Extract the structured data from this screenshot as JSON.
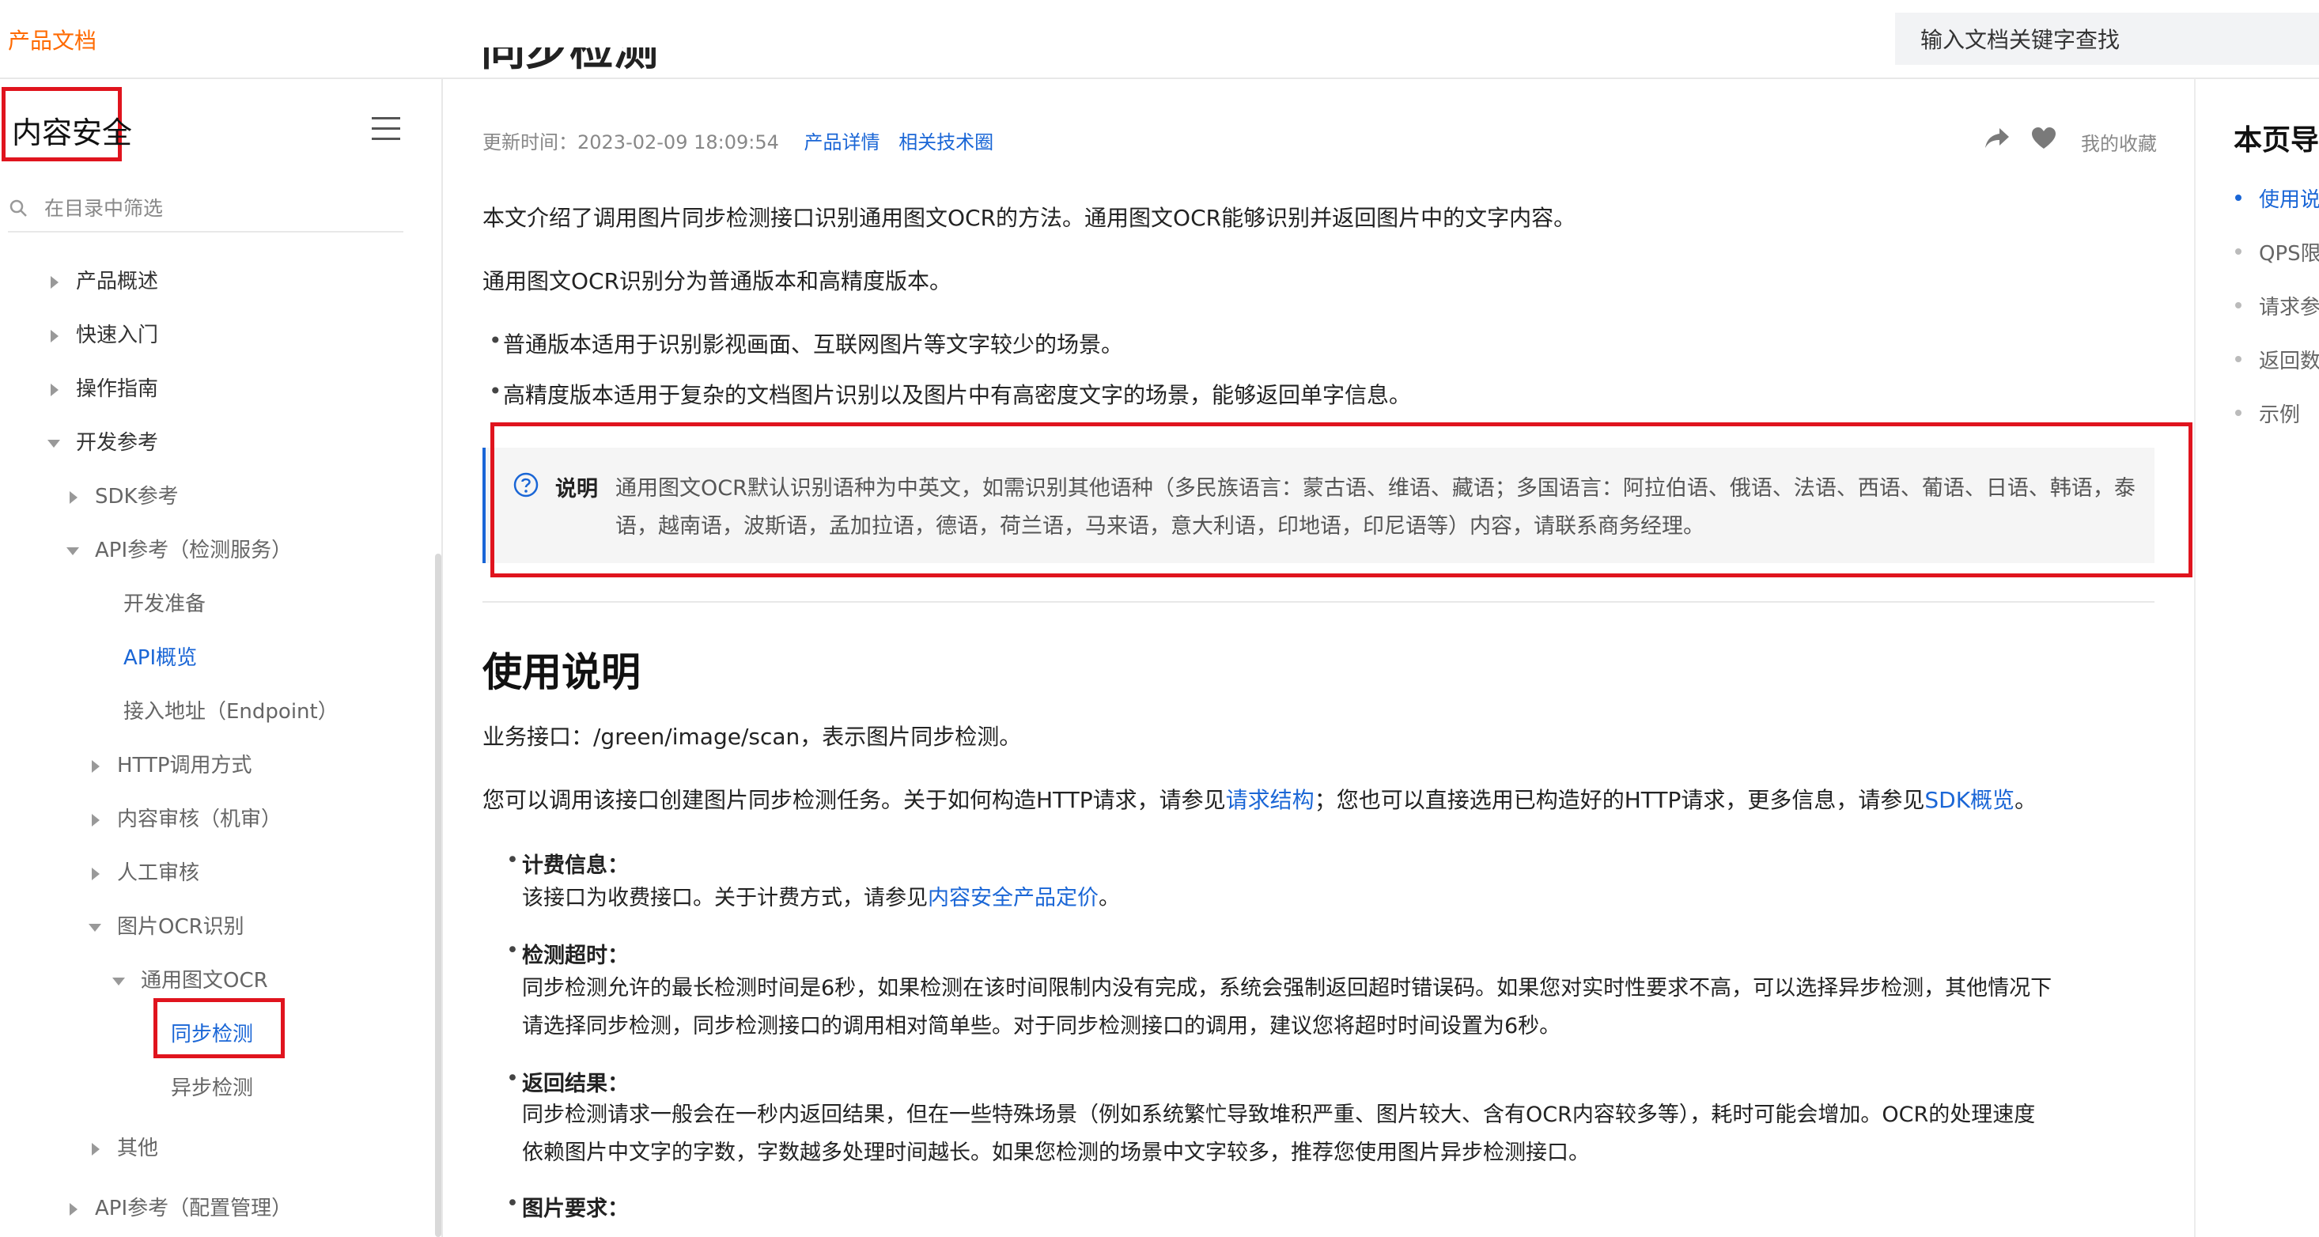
{
  "header": {
    "brand": "产品文档",
    "search_placeholder": "输入文档关键字查找"
  },
  "sidebar": {
    "title": "内容安全",
    "filter_placeholder": "在目录中筛选",
    "items": [
      {
        "label": "产品概述"
      },
      {
        "label": "快速入门"
      },
      {
        "label": "操作指南"
      },
      {
        "label": "开发参考"
      },
      {
        "label": "SDK参考"
      },
      {
        "label": "API参考（检测服务）"
      },
      {
        "label": "开发准备"
      },
      {
        "label": "API概览"
      },
      {
        "label": "接入地址（Endpoint）"
      },
      {
        "label": "HTTP调用方式"
      },
      {
        "label": "内容审核（机审）"
      },
      {
        "label": "人工审核"
      },
      {
        "label": "图片OCR识别"
      },
      {
        "label": "通用图文OCR"
      },
      {
        "label": "同步检测"
      },
      {
        "label": "异步检测"
      },
      {
        "label": "其他"
      },
      {
        "label": "API参考（配置管理）"
      }
    ]
  },
  "article": {
    "title": "同步检测",
    "meta": {
      "updated": "更新时间：2023-02-09 18:09:54",
      "link_detail": "产品详情",
      "link_circle": "相关技术圈",
      "favorite_label": "我的收藏"
    },
    "intro": "本文介绍了调用图片同步检测接口识别通用图文OCR的方法。通用图文OCR能够识别并返回图片中的文字内容。",
    "versions_intro": "通用图文OCR识别分为普通版本和高精度版本。",
    "versions": [
      "普通版本适用于识别影视画面、互联网图片等文字较少的场景。",
      "高精度版本适用于复杂的文档图片识别以及图片中有高密度文字的场景，能够返回单字信息。"
    ],
    "note": {
      "label": "说明",
      "text": "通用图文OCR默认识别语种为中英文，如需识别其他语种（多民族语言：蒙古语、维语、藏语；多国语言：阿拉伯语、俄语、法语、西语、葡语、日语、韩语，泰语，越南语，波斯语，孟加拉语，德语，荷兰语，马来语，意大利语，印地语，印尼语等）内容，请联系商务经理。"
    },
    "section_title": "使用说明",
    "api_line": "业务接口：/green/image/scan，表示图片同步检测。",
    "build_line": {
      "part1": "您可以调用该接口创建图片同步检测任务。关于如何构造HTTP请求，请参见",
      "link1": "请求结构",
      "part2": "；您也可以直接选用已构造好的HTTP请求，更多信息，请参见",
      "link2": "SDK概览",
      "part3": "。"
    },
    "details": [
      {
        "term": "计费信息：",
        "text_before": "该接口为收费接口。关于计费方式，请参见",
        "link": "内容安全产品定价",
        "text_after": "。"
      },
      {
        "term": "检测超时：",
        "line1": "同步检测允许的最长检测时间是6秒，如果检测在该时间限制内没有完成，系统会强制返回超时错误码。如果您对实时性要求不高，可以选择异步检测，其他情况下",
        "line2": "请选择同步检测，同步检测接口的调用相对简单些。对于同步检测接口的调用，建议您将超时时间设置为6秒。"
      },
      {
        "term": "返回结果：",
        "line1": "同步检测请求一般会在一秒内返回结果，但在一些特殊场景（例如系统繁忙导致堆积严重、图片较大、含有OCR内容较多等），耗时可能会增加。OCR的处理速度",
        "line2": "依赖图片中文字的字数，字数越多处理时间越长。如果您检测的场景中文字较多，推荐您使用图片异步检测接口。"
      },
      {
        "term": "图片要求："
      }
    ]
  },
  "toc": {
    "title": "本页导",
    "items": [
      "使用说",
      "QPS限",
      "请求参",
      "返回数",
      "示例"
    ]
  },
  "colors": {
    "brand": "#ff6a00",
    "link": "#1a66d6",
    "highlight": "#e0141e"
  }
}
